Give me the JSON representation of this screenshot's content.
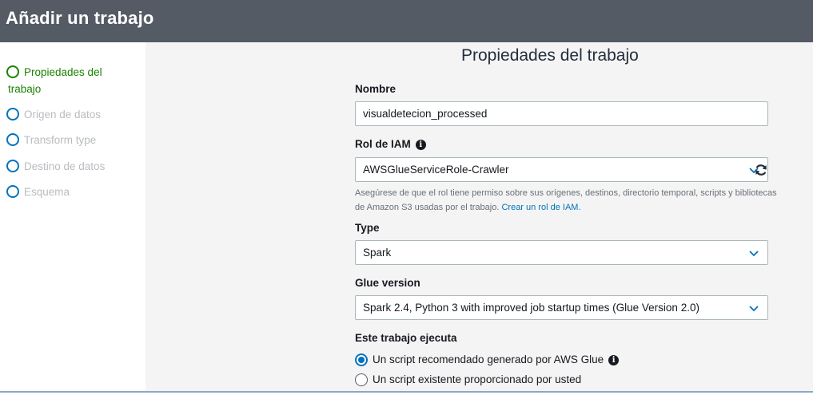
{
  "header": {
    "title": "Añadir un trabajo"
  },
  "sidebar": {
    "steps": [
      {
        "label_line1": "Propiedades del",
        "label_line2": "trabajo",
        "state": "active"
      },
      {
        "label": "Origen de datos",
        "state": "inactive"
      },
      {
        "label": "Transform type",
        "state": "inactive"
      },
      {
        "label": "Destino de datos",
        "state": "inactive"
      },
      {
        "label": "Esquema",
        "state": "inactive"
      }
    ]
  },
  "main": {
    "title": "Propiedades del trabajo",
    "nombre": {
      "label": "Nombre",
      "value": "visualdetecion_processed"
    },
    "iam_role": {
      "label": "Rol de IAM",
      "info_icon": "info-icon",
      "value": "AWSGlueServiceRole-Crawler",
      "help_text": "Asegúrese de que el rol tiene permiso sobre sus orígenes, destinos, directorio temporal, scripts y bibliotecas de Amazon S3 usadas por el trabajo.",
      "help_link": "Crear un rol de IAM."
    },
    "type": {
      "label": "Type",
      "value": "Spark"
    },
    "glue_version": {
      "label": "Glue version",
      "value": "Spark 2.4, Python 3 with improved job startup times (Glue Version 2.0)"
    },
    "runs": {
      "label": "Este trabajo ejecuta",
      "options": [
        {
          "label": "Un script recomendado generado por AWS Glue",
          "selected": true
        },
        {
          "label": "Un script existente proporcionado por usted",
          "selected": false
        }
      ]
    }
  },
  "colors": {
    "header_bg": "#545b64",
    "active_step": "#1d8102",
    "accent": "#0073bb",
    "inactive_text": "#b8bcc0"
  }
}
